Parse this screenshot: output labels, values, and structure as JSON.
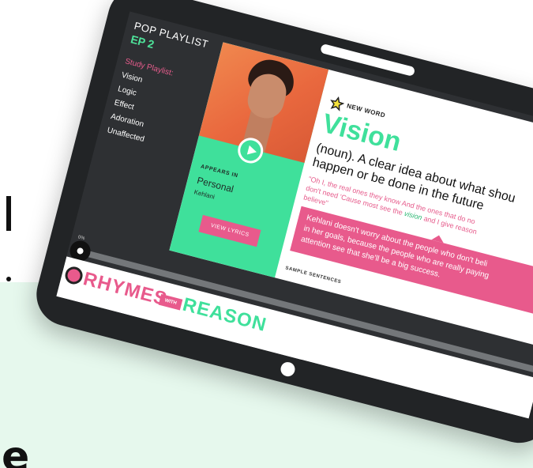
{
  "sidebar": {
    "title": "POP PLAYLIST",
    "episode": "EP 2",
    "study_label": "Study Playlist:",
    "items": [
      "Vision",
      "Logic",
      "Effect",
      "Adoration",
      "Unaffected"
    ]
  },
  "card": {
    "appears_in_label": "APPEARS IN",
    "song_title": "Personal",
    "artist": "Kehlani",
    "lyrics_button": "VIEW LYRICS",
    "new_word_label": "NEW WORD",
    "word": "Vision",
    "definition_line1": "(noun). A clear idea about what shou",
    "definition_line2": "happen or be done in the future",
    "lyric_line1": "\"Oh I, the real ones they know And the ones that do no",
    "lyric_line2a": "don't need 'Cause most see the ",
    "lyric_highlight": "vision",
    "lyric_line2b": " and I give reason",
    "lyric_line3": "believe\"",
    "sentence_line1": "Kehlani doesn't worry about the people who don't beli",
    "sentence_line2": "in her goals, because the people who are really paying",
    "sentence_line3": "attention see that she'll be a big success.",
    "sample_label": "SAMPLE SENTENCES"
  },
  "progress": {
    "percent_label": "0%",
    "value": 0
  },
  "logo": {
    "rhymes": "RHYMES",
    "with": "WITH",
    "reason": "REASON"
  },
  "colors": {
    "accent_green": "#3fe09b",
    "accent_pink": "#e85a8c",
    "tablet_body": "#222426",
    "mint_background": "#e6f8ed"
  }
}
